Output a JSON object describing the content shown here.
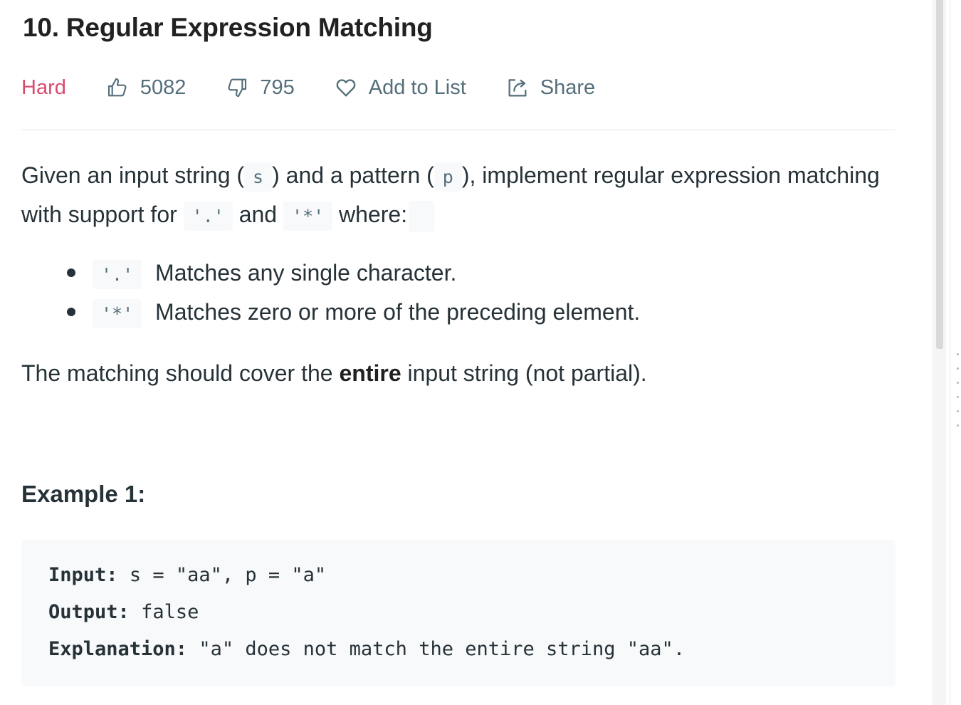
{
  "problem": {
    "title": "10. Regular Expression Matching",
    "difficulty": "Hard",
    "likes": "5082",
    "dislikes": "795",
    "add_to_list_label": "Add to List",
    "share_label": "Share"
  },
  "description": {
    "intro_part1": "Given an input string (",
    "code_s": "s",
    "intro_part2": ") and a pattern (",
    "code_p": "p",
    "intro_part3": "), implement regular expression matching with support for",
    "code_dot": "'.'",
    "intro_and": "and",
    "code_star": "'*'",
    "intro_where": "where:",
    "rules": [
      {
        "code": "'.'",
        "text": "Matches any single character."
      },
      {
        "code": "'*'",
        "text": "Matches zero or more of the preceding element."
      }
    ],
    "cover_part1": "The matching should cover the",
    "cover_bold": "entire",
    "cover_part2": "input string (not partial)."
  },
  "example1": {
    "title": "Example 1:",
    "input_label": "Input:",
    "input_value": "s = \"aa\", p = \"a\"",
    "output_label": "Output:",
    "output_value": "false",
    "explanation_label": "Explanation:",
    "explanation_value": "\"a\" does not match the entire string \"aa\"."
  },
  "colors": {
    "difficulty_hard": "#d84b6f",
    "meta_text": "#546e7a",
    "code_background": "#f7f9fa"
  },
  "icons": {
    "likes": "thumbs-up-icon",
    "dislikes": "thumbs-down-icon",
    "add_to_list": "heart-icon",
    "share": "share-icon"
  }
}
